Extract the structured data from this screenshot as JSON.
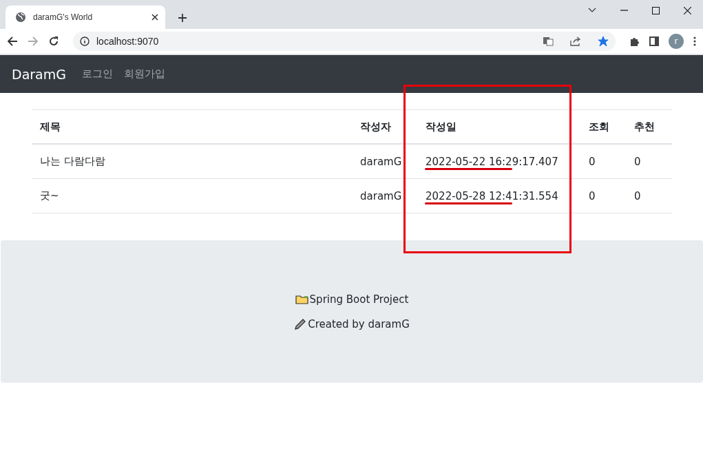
{
  "browser": {
    "tab_title": "daramG's World",
    "url": "localhost:9070",
    "bookmarked": true,
    "avatar_letter": "r"
  },
  "navbar": {
    "brand": "DaramG",
    "links": [
      "로그인",
      "회원가입"
    ]
  },
  "table": {
    "columns": [
      "제목",
      "작성자",
      "작성일",
      "조회",
      "추천"
    ],
    "rows": [
      [
        "나는 다람다람",
        "daramG",
        "2022-05-22 16:29:17.407",
        "0",
        "0"
      ],
      [
        "굿~",
        "daramG",
        "2022-05-28 12:41:31.554",
        "0",
        "0"
      ]
    ]
  },
  "footer": {
    "lines": [
      {
        "kind": "folder",
        "text": "Spring Boot Project"
      },
      {
        "kind": "pencil",
        "text": "Created by daramG"
      }
    ]
  }
}
